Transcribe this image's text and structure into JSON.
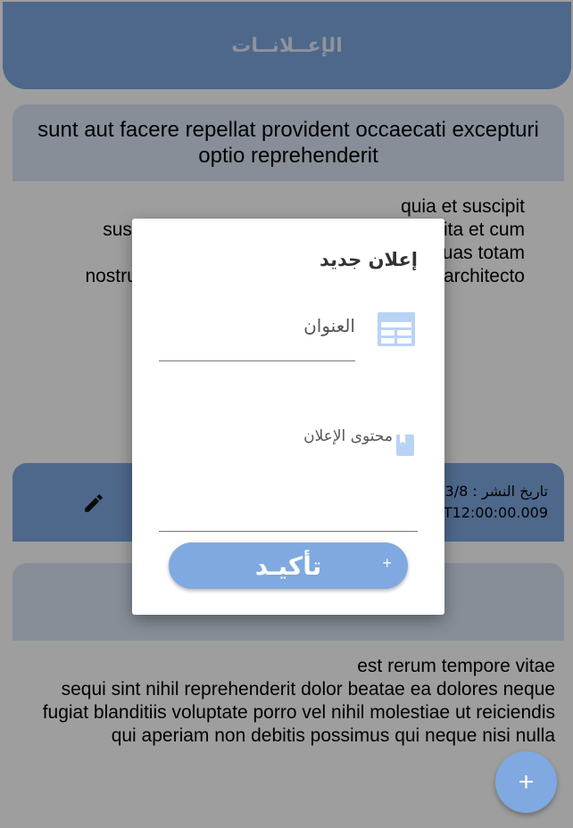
{
  "appbar": {
    "title": "الإعــلانــات"
  },
  "posts": [
    {
      "title": "sunt aut facere repellat provident occaecati excepturi optio reprehenderit",
      "body_lines": [
        "quia et suscipit",
        "suscipit recusandae consequuntur expedita et cum",
        "reprehenderit molestiae ut ut quas totam",
        "nostrum rerum est autem sunt rem eveniet architecto"
      ],
      "date_label": "تاريخ النشر : 2020/3/8",
      "date_line2": "2020-03-08T12:00:00.009"
    },
    {
      "title": "",
      "body_lines": [
        "est rerum tempore vitae",
        "sequi sint nihil reprehenderit dolor beatae ea dolores neque",
        "fugiat blanditiis voluptate porro vel nihil molestiae ut reiciendis",
        "qui aperiam non debitis possimus qui neque nisi nulla"
      ]
    }
  ],
  "dialog": {
    "title": "إعلان جديد",
    "title_placeholder": "العنوان",
    "content_placeholder": "محتوى الإعلان",
    "confirm_label": "تأكيـد",
    "confirm_icon": "+"
  },
  "fab": {
    "icon": "+"
  },
  "colors": {
    "primary": "#7fa9e0",
    "header_light": "#dae6f6"
  }
}
